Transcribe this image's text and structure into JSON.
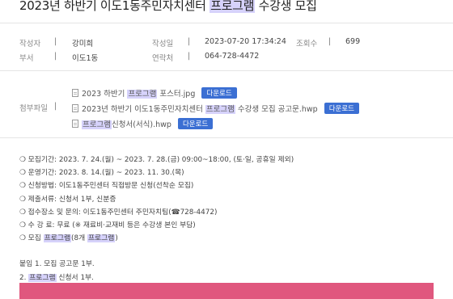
{
  "post": {
    "title_pre": "2023년 하반기 이도1동주민자치센터 ",
    "title_hl": "프로그램",
    "title_post": " 수강생 모집"
  },
  "meta": {
    "author_label": "작성자",
    "author": "강미희",
    "date_label": "작성일",
    "date": "2023-07-20 17:34:24",
    "views_label": "조회수",
    "views": "699",
    "dept_label": "부서",
    "dept": "이도1동",
    "contact_label": "연락처",
    "contact": "064-728-4472"
  },
  "attachments": {
    "label": "첨부파일",
    "download_label": "다운로드",
    "files": [
      {
        "pre": "2023 하반기 ",
        "hl": "프로그램",
        "post": " 포스터.jpg"
      },
      {
        "pre": "2023년 하반기 이도1동주민자치센터 ",
        "hl": "프로그램",
        "post": " 수강생 모집 공고문.hwp"
      },
      {
        "pre": "",
        "hl": "프로그램",
        "post": "신청서(서식).hwp"
      }
    ]
  },
  "body": {
    "lines": [
      "❍ 모집기간: 2023. 7. 24.(월) ~ 2023. 7. 28.(금) 09:00~18:00, (토·일, 공휴일 제외)",
      "❍ 운영기간: 2023. 8. 14.(월) ~ 2023. 11. 30.(목)",
      "❍ 신청방법: 이도1동주민센터 직접방문 신청(선착순 모집)",
      "❍ 제출서류: 신청서 1부, 신분증",
      "❍ 접수장소 및 문의: 이도1동주민센터 주민자치팀(☎728-4472)",
      "❍ 수 강 료: 무료 (※ 재료비·교재비 등은 수강생 본인 부담)"
    ],
    "recruit": {
      "pre": "❍ 모집 ",
      "hl1": "프로그램",
      "mid": "(8개 ",
      "hl2": "프로그램",
      "post": ")"
    },
    "attach_head": "붙임 1. 모집 공고문 1부.",
    "attach_2": {
      "pre": "2. ",
      "hl": "프로그램",
      "post": " 신청서 1부."
    }
  },
  "colors": {
    "download_button": "#3b6fd3",
    "highlight": "#d6d2fb",
    "banner": "#e0577e"
  }
}
